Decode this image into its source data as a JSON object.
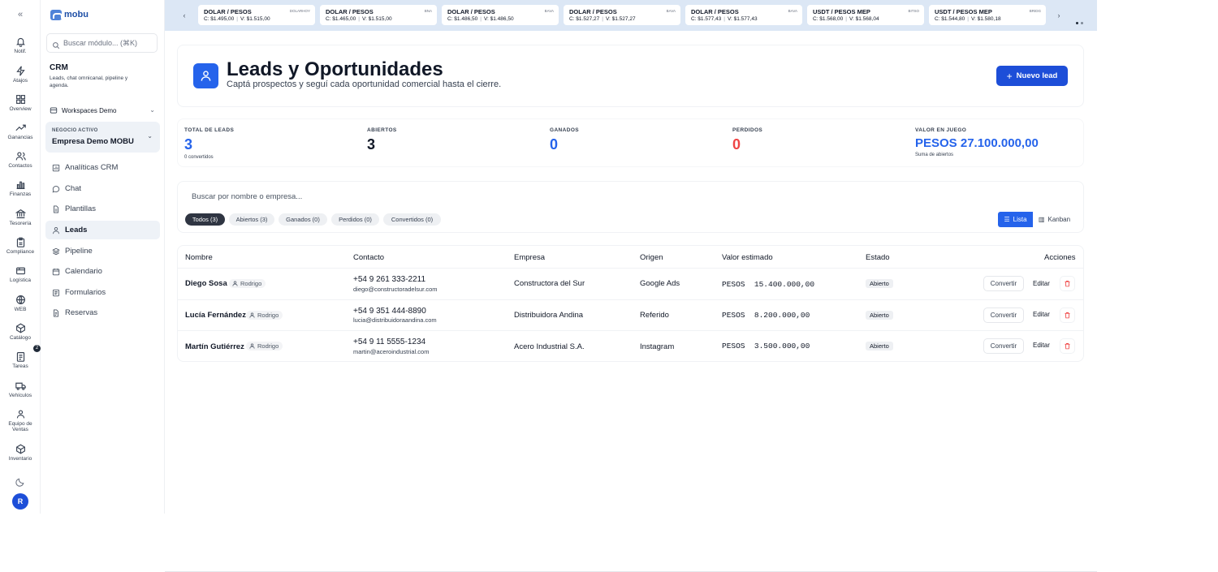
{
  "brand": {
    "logo_text": "mobu"
  },
  "rail": {
    "items": [
      {
        "label": "Notif."
      },
      {
        "label": "Atajos"
      },
      {
        "label": "Overview"
      },
      {
        "label": "Ganancias"
      },
      {
        "label": "Contactos"
      },
      {
        "label": "Finanzas"
      },
      {
        "label": "Tesorería"
      },
      {
        "label": "Compliance"
      },
      {
        "label": "Logística"
      },
      {
        "label": "WEB"
      },
      {
        "label": "Catálogo"
      },
      {
        "label": "Tareas"
      },
      {
        "label": "Vehículos"
      },
      {
        "label": "Equipo de Ventas"
      },
      {
        "label": "Inventario"
      }
    ],
    "tareas_badge": "2",
    "avatar_initial": "R"
  },
  "sidebar": {
    "search_placeholder": "Buscar módulo... (⌘K)",
    "module_title": "CRM",
    "module_desc": "Leads, chat omnicanal, pipeline y agenda.",
    "workspace": "Workspaces Demo",
    "business_label": "NEGOCIO ACTIVO",
    "business_name": "Empresa Demo MOBU",
    "nav": [
      {
        "label": "Analíticas CRM"
      },
      {
        "label": "Chat"
      },
      {
        "label": "Plantillas"
      },
      {
        "label": "Leads"
      },
      {
        "label": "Pipeline"
      },
      {
        "label": "Calendario"
      },
      {
        "label": "Formularios"
      },
      {
        "label": "Reservas"
      }
    ]
  },
  "ticker": [
    {
      "pair": "DOLAR / PESOS",
      "tag": "DOLARHOY",
      "c": "C: $1.495,00",
      "v": "V: $1.515,00"
    },
    {
      "pair": "DOLAR / PESOS",
      "tag": "BNA",
      "c": "C: $1.465,00",
      "v": "V: $1.515,00"
    },
    {
      "pair": "DOLAR / PESOS",
      "tag": "BAVA",
      "c": "C: $1.486,50",
      "v": "V: $1.486,50"
    },
    {
      "pair": "DOLAR / PESOS",
      "tag": "BAVA",
      "c": "C: $1.527,27",
      "v": "V: $1.527,27"
    },
    {
      "pair": "DOLAR / PESOS",
      "tag": "BAVA",
      "c": "C: $1.577,43",
      "v": "V: $1.577,43"
    },
    {
      "pair": "USDT / PESOS MEP",
      "tag": "BITSO",
      "c": "C: $1.568,00",
      "v": "V: $1.568,04"
    },
    {
      "pair": "USDT / PESOS MEP",
      "tag": "BRIDG",
      "c": "C: $1.544,80",
      "v": "V: $1.580,18"
    }
  ],
  "header": {
    "title": "Leads y Oportunidades",
    "subtitle": "Captá prospectos y seguí cada oportunidad comercial hasta el cierre.",
    "new_button": "Nuevo lead"
  },
  "stats": [
    {
      "label": "TOTAL DE LEADS",
      "value": "3",
      "sub": "0 convertidos"
    },
    {
      "label": "ABIERTOS",
      "value": "3",
      "sub": ""
    },
    {
      "label": "GANADOS",
      "value": "0",
      "sub": ""
    },
    {
      "label": "PERDIDOS",
      "value": "0",
      "sub": ""
    },
    {
      "label": "VALOR EN JUEGO",
      "value": "PESOS 27.100.000,00",
      "sub": "Suma de abiertos"
    }
  ],
  "filters": {
    "search_placeholder": "Buscar por nombre o empresa...",
    "chips": [
      "Todos (3)",
      "Abiertos (3)",
      "Ganados (0)",
      "Perdidos (0)",
      "Convertidos (0)"
    ],
    "view_list": "Lista",
    "view_kanban": "Kanban"
  },
  "table": {
    "headers": [
      "Nombre",
      "Contacto",
      "Empresa",
      "Origen",
      "Valor estimado",
      "Estado",
      "Acciones"
    ],
    "rows": [
      {
        "name": "Diego Sosa",
        "owner": "Rodrigo",
        "phone": "+54 9 261 333-2211",
        "email": "diego@constructoradelsur.com",
        "company": "Constructora del Sur",
        "origin": "Google Ads",
        "value": "PESOS  15.400.000,00",
        "status": "Abierto"
      },
      {
        "name": "Lucía Fernández",
        "owner": "Rodrigo",
        "phone": "+54 9 351 444-8890",
        "email": "lucia@distribuidoraandina.com",
        "company": "Distribuidora Andina",
        "origin": "Referido",
        "value": "PESOS  8.200.000,00",
        "status": "Abierto"
      },
      {
        "name": "Martín Gutiérrez",
        "owner": "Rodrigo",
        "phone": "+54 9 11 5555-1234",
        "email": "martin@aceroindustrial.com",
        "company": "Acero Industrial S.A.",
        "origin": "Instagram",
        "value": "PESOS  3.500.000,00",
        "status": "Abierto"
      }
    ],
    "convert_label": "Convertir",
    "edit_label": "Editar"
  },
  "colors": {
    "accent": "#2563eb",
    "accent_dark": "#1d4ed8",
    "ticker_bg": "#dce7f5",
    "danger": "#ef4444"
  }
}
